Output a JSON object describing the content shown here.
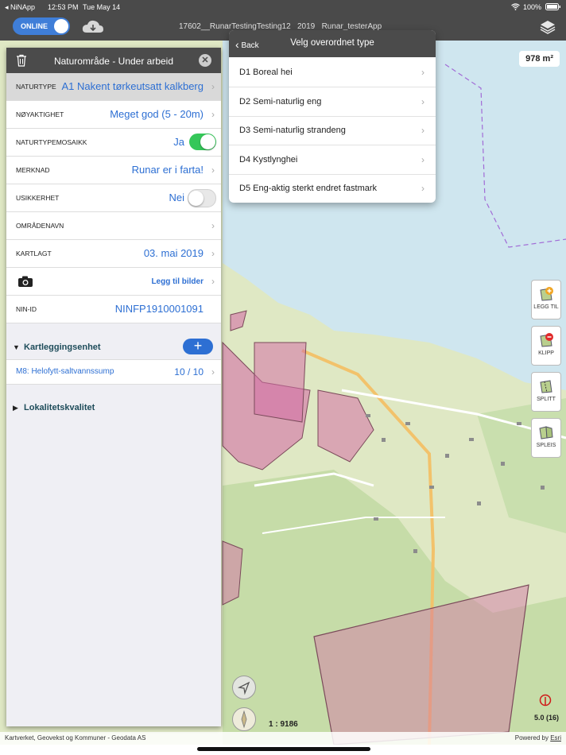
{
  "status_bar": {
    "app": "◂ NiNApp",
    "time": "12:53 PM",
    "date": "Tue May 14",
    "battery": "100%"
  },
  "toolbar": {
    "online_label": "ONLINE",
    "project_title": "17602__RunarTestingTesting12   2019   Runar_testerApp",
    "icons": [
      "cloud-download-icon",
      "layers-icon"
    ]
  },
  "map": {
    "area_value": "978 m²",
    "scale": "1 : 9186",
    "zoom": "5.0 (16)",
    "attribution": "Kartverket, Geovekst og Kommuner - Geodata AS",
    "powered_by": "Powered by",
    "powered_link": "Esri",
    "tools": [
      {
        "label": "LEGG TIL",
        "icon": "add-polygon-icon"
      },
      {
        "label": "KLIPP",
        "icon": "cut-polygon-icon"
      },
      {
        "label": "SPLITT",
        "icon": "split-polygon-icon"
      },
      {
        "label": "SPLEIS",
        "icon": "merge-polygon-icon"
      }
    ],
    "colors": {
      "polygon_fill": "#d36fa6",
      "water": "#cfe6ef",
      "forest": "#c6dca8"
    }
  },
  "panel": {
    "title": "Naturområde - Under arbeid",
    "fields": [
      {
        "label": "NATURTYPE",
        "value": "A1 Nakent tørkeutsatt kalkberg"
      },
      {
        "label": "NØYAKTIGHET",
        "value": "Meget god (5 - 20m)"
      },
      {
        "label": "NATURTYPEMOSAIKK",
        "value": "Ja"
      },
      {
        "label": "MERKNAD",
        "value": "Runar er i farta!"
      },
      {
        "label": "USIKKERHET",
        "value": "Nei"
      },
      {
        "label": "OMRÅDENAVN",
        "value": ""
      },
      {
        "label": "KARTLAGT",
        "value": "03. mai 2019"
      },
      {
        "label": "",
        "value": "Legg til bilder"
      },
      {
        "label": "NIN-ID",
        "value": "NINFP1910001091"
      }
    ],
    "sections": {
      "kartlegging": "Kartleggingsenhet",
      "lokalitet": "Lokalitetskvalitet"
    },
    "unit": {
      "name": "M8: Helofytt-saltvannssump",
      "count": "10 / 10"
    }
  },
  "popover": {
    "back": "Back",
    "title": "Velg overordnet type",
    "items": [
      "D1 Boreal hei",
      "D2 Semi-naturlig eng",
      "D3 Semi-naturlig strandeng",
      "D4 Kystlynghei",
      "D5 Eng-aktig sterkt endret fastmark"
    ]
  }
}
